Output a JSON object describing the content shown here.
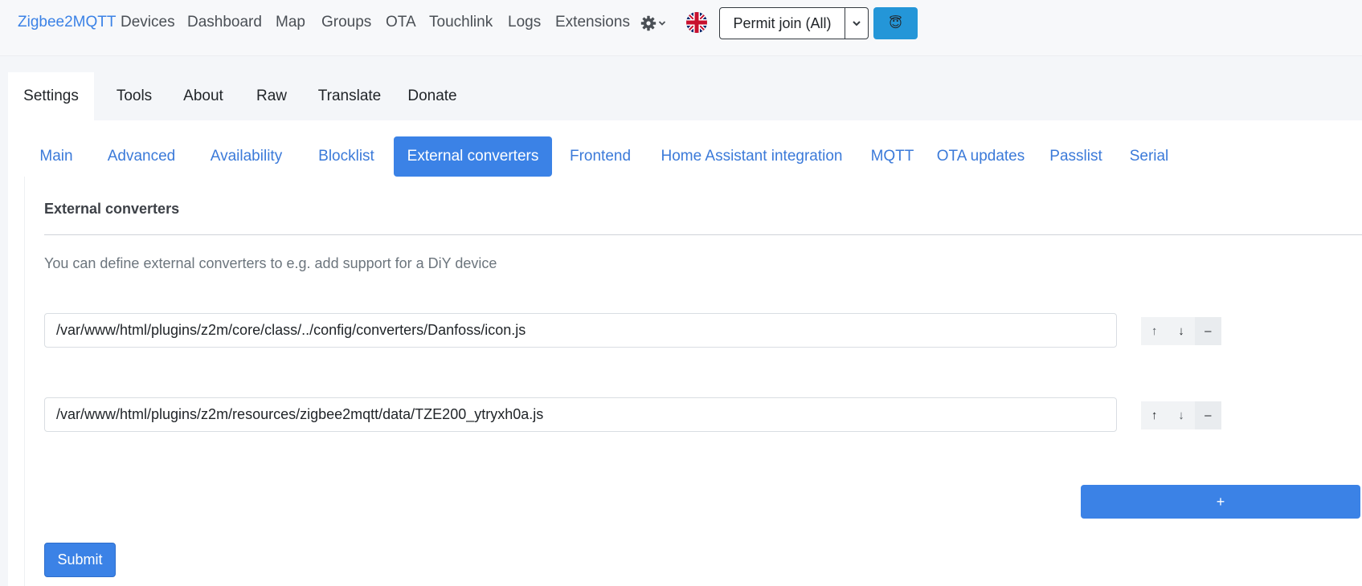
{
  "navbar": {
    "brand": "Zigbee2MQTT",
    "links": [
      "Devices",
      "Dashboard",
      "Map",
      "Groups",
      "OTA",
      "Touchlink",
      "Logs",
      "Extensions"
    ],
    "permit_join": "Permit join (All)",
    "user_emoji": "😇"
  },
  "top_tabs": [
    "Settings",
    "Tools",
    "About",
    "Raw",
    "Translate",
    "Donate"
  ],
  "active_top_tab": "Settings",
  "sub_tabs": [
    "Main",
    "Advanced",
    "Availability",
    "Blocklist",
    "External converters",
    "Frontend",
    "Home Assistant integration",
    "MQTT",
    "OTA updates",
    "Passlist",
    "Serial"
  ],
  "active_sub_tab": "External converters",
  "section": {
    "title": "External converters",
    "description": "You can define external converters to e.g. add support for a DiY device",
    "entries": [
      "/var/www/html/plugins/z2m/core/class/../config/converters/Danfoss/icon.js",
      "/var/www/html/plugins/z2m/resources/zigbee2mqtt/data/TZE200_ytryxh0a.js"
    ],
    "up_glyph": "↑",
    "down_glyph": "↓",
    "remove_glyph": "–",
    "add_label": "+",
    "submit_label": "Submit"
  },
  "colors": {
    "primary": "#3b82e6",
    "link": "#3b7ad9",
    "user_button": "#2496d8"
  }
}
